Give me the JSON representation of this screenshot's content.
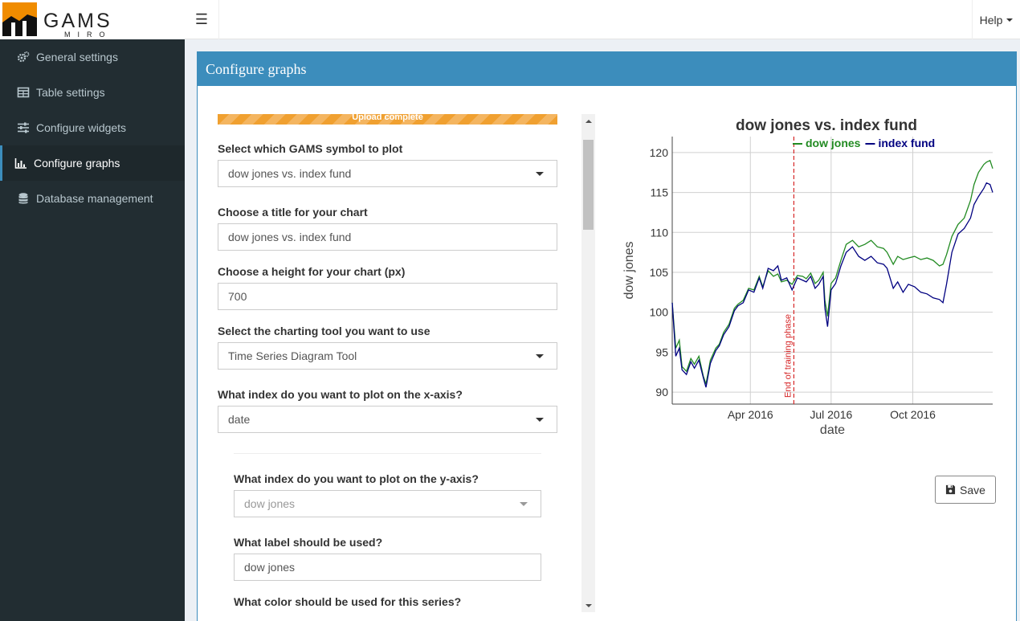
{
  "app": {
    "logo_text": "GAMS",
    "logo_subtext": "MIRO"
  },
  "sidebar": {
    "items": [
      {
        "label": "General settings",
        "icon": "gears-icon"
      },
      {
        "label": "Table settings",
        "icon": "table-icon"
      },
      {
        "label": "Configure widgets",
        "icon": "sliders-icon"
      },
      {
        "label": "Configure graphs",
        "icon": "bar-chart-icon",
        "active": true
      },
      {
        "label": "Database management",
        "icon": "database-icon"
      }
    ]
  },
  "header": {
    "menu_icon": "hamburger-icon",
    "help_label": "Help"
  },
  "box": {
    "title": "Configure graphs"
  },
  "form": {
    "upload_text": "Upload complete",
    "symbol_label": "Select which GAMS symbol to plot",
    "symbol_value": "dow jones vs. index fund",
    "title_label": "Choose a title for your chart",
    "title_value": "dow jones vs. index fund",
    "height_label": "Choose a height for your chart (px)",
    "height_value": "700",
    "tool_label": "Select the charting tool you want to use",
    "tool_value": "Time Series Diagram Tool",
    "xaxis_label": "What index do you want to plot on the x-axis?",
    "xaxis_value": "date",
    "yaxis_label": "What index do you want to plot on the y-axis?",
    "yaxis_value": "dow jones",
    "series_label_label": "What label should be used?",
    "series_label_value": "dow jones",
    "color_label": "What color should be used for this series?"
  },
  "chart_data": {
    "type": "line",
    "title": "dow jones vs. index fund",
    "xlabel": "date",
    "ylabel": "dow jones",
    "ylim": [
      88.5,
      122
    ],
    "yticks": [
      90,
      95,
      100,
      105,
      110,
      115,
      120
    ],
    "xticks": [
      {
        "date": "2016-04-01",
        "label": "Apr 2016"
      },
      {
        "date": "2016-07-01",
        "label": "Jul 2016"
      },
      {
        "date": "2016-10-01",
        "label": "Oct 2016"
      }
    ],
    "xlim": [
      "2016-01-04",
      "2016-12-30"
    ],
    "grid": true,
    "legend_position": "top",
    "annotation": {
      "date": "2016-05-20",
      "label": "End of training phase",
      "color": "#d62728"
    },
    "series": [
      {
        "name": "dow jones",
        "color": "#228b22",
        "points": [
          [
            "2016-01-04",
            101.2
          ],
          [
            "2016-01-08",
            95.5
          ],
          [
            "2016-01-12",
            96.5
          ],
          [
            "2016-01-15",
            93.2
          ],
          [
            "2016-01-20",
            92.6
          ],
          [
            "2016-01-25",
            94.2
          ],
          [
            "2016-01-29",
            93.5
          ],
          [
            "2016-02-03",
            94.5
          ],
          [
            "2016-02-08",
            92.0
          ],
          [
            "2016-02-11",
            91.0
          ],
          [
            "2016-02-16",
            94.0
          ],
          [
            "2016-02-22",
            95.5
          ],
          [
            "2016-02-26",
            96.0
          ],
          [
            "2016-03-02",
            97.5
          ],
          [
            "2016-03-08",
            98.5
          ],
          [
            "2016-03-14",
            100.5
          ],
          [
            "2016-03-18",
            101.0
          ],
          [
            "2016-03-24",
            101.5
          ],
          [
            "2016-03-30",
            103.0
          ],
          [
            "2016-04-05",
            102.8
          ],
          [
            "2016-04-11",
            104.5
          ],
          [
            "2016-04-15",
            103.2
          ],
          [
            "2016-04-21",
            105.2
          ],
          [
            "2016-04-27",
            104.5
          ],
          [
            "2016-05-02",
            104.8
          ],
          [
            "2016-05-06",
            103.8
          ],
          [
            "2016-05-12",
            104.0
          ],
          [
            "2016-05-18",
            103.5
          ],
          [
            "2016-05-24",
            104.6
          ],
          [
            "2016-05-30",
            104.5
          ],
          [
            "2016-06-03",
            104.2
          ],
          [
            "2016-06-08",
            104.9
          ],
          [
            "2016-06-13",
            103.6
          ],
          [
            "2016-06-17",
            104.0
          ],
          [
            "2016-06-22",
            105.0
          ],
          [
            "2016-06-24",
            101.5
          ],
          [
            "2016-06-27",
            99.5
          ],
          [
            "2016-07-01",
            103.6
          ],
          [
            "2016-07-06",
            104.3
          ],
          [
            "2016-07-12",
            106.5
          ],
          [
            "2016-07-18",
            108.5
          ],
          [
            "2016-07-25",
            109.0
          ],
          [
            "2016-08-01",
            108.2
          ],
          [
            "2016-08-08",
            108.5
          ],
          [
            "2016-08-15",
            109.0
          ],
          [
            "2016-08-22",
            108.2
          ],
          [
            "2016-08-29",
            108.0
          ],
          [
            "2016-09-02",
            107.5
          ],
          [
            "2016-09-09",
            106.0
          ],
          [
            "2016-09-14",
            107.0
          ],
          [
            "2016-09-20",
            106.6
          ],
          [
            "2016-09-26",
            106.8
          ],
          [
            "2016-10-03",
            107.0
          ],
          [
            "2016-10-10",
            106.6
          ],
          [
            "2016-10-17",
            106.8
          ],
          [
            "2016-10-24",
            106.5
          ],
          [
            "2016-10-31",
            105.8
          ],
          [
            "2016-11-04",
            106.0
          ],
          [
            "2016-11-08",
            107.2
          ],
          [
            "2016-11-14",
            109.5
          ],
          [
            "2016-11-21",
            111.0
          ],
          [
            "2016-11-28",
            111.8
          ],
          [
            "2016-12-05",
            114.0
          ],
          [
            "2016-12-09",
            116.0
          ],
          [
            "2016-12-14",
            117.5
          ],
          [
            "2016-12-20",
            118.5
          ],
          [
            "2016-12-23",
            118.8
          ],
          [
            "2016-12-27",
            119.0
          ],
          [
            "2016-12-30",
            118.0
          ]
        ]
      },
      {
        "name": "index fund",
        "color": "#000080",
        "points": [
          [
            "2016-01-04",
            101.2
          ],
          [
            "2016-01-08",
            94.5
          ],
          [
            "2016-01-12",
            95.5
          ],
          [
            "2016-01-15",
            92.8
          ],
          [
            "2016-01-20",
            92.2
          ],
          [
            "2016-01-25",
            93.8
          ],
          [
            "2016-01-29",
            93.0
          ],
          [
            "2016-02-03",
            94.0
          ],
          [
            "2016-02-08",
            91.8
          ],
          [
            "2016-02-11",
            90.6
          ],
          [
            "2016-02-16",
            93.6
          ],
          [
            "2016-02-22",
            95.2
          ],
          [
            "2016-02-26",
            95.8
          ],
          [
            "2016-03-02",
            97.2
          ],
          [
            "2016-03-08",
            98.2
          ],
          [
            "2016-03-14",
            100.2
          ],
          [
            "2016-03-18",
            100.8
          ],
          [
            "2016-03-24",
            101.2
          ],
          [
            "2016-03-30",
            102.8
          ],
          [
            "2016-04-05",
            102.5
          ],
          [
            "2016-04-11",
            104.3
          ],
          [
            "2016-04-15",
            103.0
          ],
          [
            "2016-04-21",
            105.5
          ],
          [
            "2016-04-27",
            105.2
          ],
          [
            "2016-05-02",
            105.8
          ],
          [
            "2016-05-06",
            104.0
          ],
          [
            "2016-05-12",
            104.3
          ],
          [
            "2016-05-18",
            102.8
          ],
          [
            "2016-05-24",
            104.3
          ],
          [
            "2016-05-30",
            104.0
          ],
          [
            "2016-06-03",
            103.8
          ],
          [
            "2016-06-08",
            104.5
          ],
          [
            "2016-06-13",
            103.0
          ],
          [
            "2016-06-17",
            103.5
          ],
          [
            "2016-06-22",
            104.5
          ],
          [
            "2016-06-24",
            100.5
          ],
          [
            "2016-06-27",
            98.2
          ],
          [
            "2016-07-01",
            102.8
          ],
          [
            "2016-07-06",
            103.6
          ],
          [
            "2016-07-12",
            105.8
          ],
          [
            "2016-07-18",
            107.5
          ],
          [
            "2016-07-25",
            108.2
          ],
          [
            "2016-08-01",
            107.0
          ],
          [
            "2016-08-08",
            106.5
          ],
          [
            "2016-08-15",
            107.0
          ],
          [
            "2016-08-22",
            106.2
          ],
          [
            "2016-08-29",
            106.0
          ],
          [
            "2016-09-02",
            105.5
          ],
          [
            "2016-09-09",
            103.0
          ],
          [
            "2016-09-14",
            103.8
          ],
          [
            "2016-09-20",
            102.5
          ],
          [
            "2016-09-26",
            103.5
          ],
          [
            "2016-10-03",
            103.2
          ],
          [
            "2016-10-10",
            102.5
          ],
          [
            "2016-10-17",
            102.3
          ],
          [
            "2016-10-24",
            101.8
          ],
          [
            "2016-10-31",
            101.6
          ],
          [
            "2016-11-04",
            101.2
          ],
          [
            "2016-11-08",
            103.5
          ],
          [
            "2016-11-14",
            107.5
          ],
          [
            "2016-11-21",
            109.8
          ],
          [
            "2016-11-28",
            110.5
          ],
          [
            "2016-12-05",
            111.8
          ],
          [
            "2016-12-09",
            113.5
          ],
          [
            "2016-12-14",
            114.5
          ],
          [
            "2016-12-20",
            115.5
          ],
          [
            "2016-12-23",
            116.2
          ],
          [
            "2016-12-27",
            116.0
          ],
          [
            "2016-12-30",
            115.0
          ]
        ]
      }
    ]
  },
  "save_label": "Save"
}
